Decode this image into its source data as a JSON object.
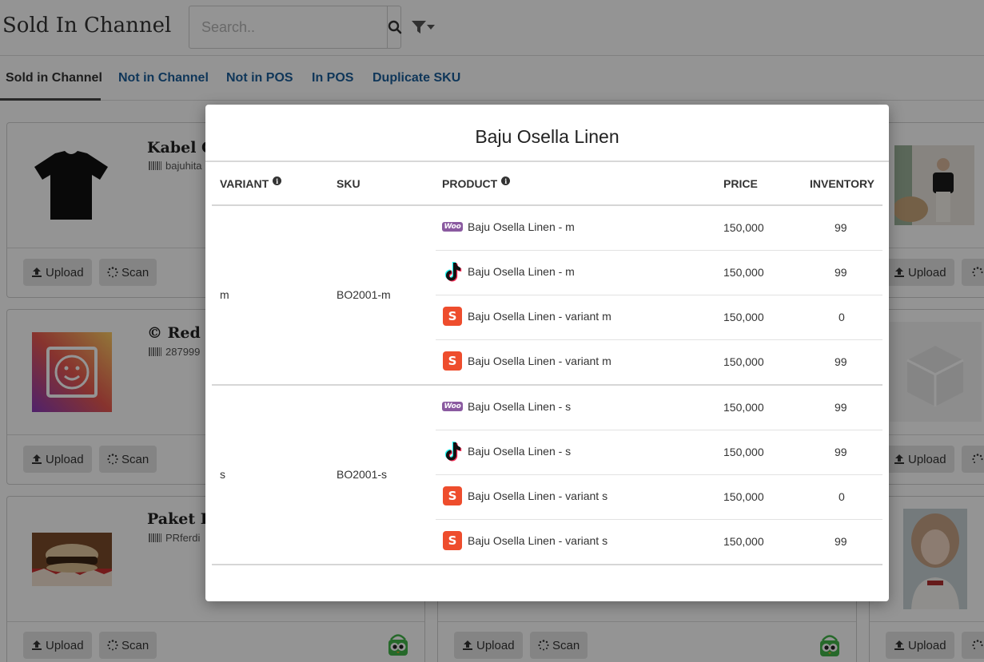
{
  "header": {
    "title": "Sold In Channel",
    "search_placeholder": "Search..",
    "search_icon": "search-icon",
    "filter_icon": "filter-icon"
  },
  "tabs": [
    {
      "label": "Sold in Channel",
      "active": true
    },
    {
      "label": "Not in Channel",
      "active": false
    },
    {
      "label": "Not in POS",
      "active": false
    },
    {
      "label": "In POS",
      "active": false
    },
    {
      "label": "Duplicate SKU",
      "active": false
    }
  ],
  "cards": [
    {
      "name": "Kabel C",
      "sku": "bajuhita",
      "upload_label": "Upload",
      "scan_label": "Scan"
    },
    {
      "name": "© Red S",
      "sku": "287999",
      "upload_label": "Upload",
      "scan_label": "Scan"
    },
    {
      "name": "Paket R",
      "sku": "PRferdi",
      "upload_label": "Upload",
      "scan_label": "Scan"
    }
  ],
  "right_cards": [
    {
      "upload_label": "Upload"
    },
    {
      "upload_label": "Upload"
    },
    {
      "upload_label": "Upload"
    }
  ],
  "middle_card": {
    "upload_label": "Upload",
    "scan_label": "Scan"
  },
  "modal": {
    "title": "Baju Osella Linen",
    "columns": {
      "variant": "VARIANT",
      "sku": "SKU",
      "product": "PRODUCT",
      "price": "PRICE",
      "inventory": "INVENTORY"
    },
    "groups": [
      {
        "variant": "m",
        "sku": "BO2001-m",
        "rows": [
          {
            "channel": "woocommerce",
            "product": "Baju Osella Linen - m",
            "price": "150,000",
            "inventory": "99"
          },
          {
            "channel": "tiktok",
            "product": "Baju Osella Linen - m",
            "price": "150,000",
            "inventory": "99"
          },
          {
            "channel": "shopee",
            "product": "Baju Osella Linen - variant m",
            "price": "150,000",
            "inventory": "0"
          },
          {
            "channel": "shopee",
            "product": "Baju Osella Linen - variant m",
            "price": "150,000",
            "inventory": "99"
          }
        ]
      },
      {
        "variant": "s",
        "sku": "BO2001-s",
        "rows": [
          {
            "channel": "woocommerce",
            "product": "Baju Osella Linen - s",
            "price": "150,000",
            "inventory": "99"
          },
          {
            "channel": "tiktok",
            "product": "Baju Osella Linen - s",
            "price": "150,000",
            "inventory": "99"
          },
          {
            "channel": "shopee",
            "product": "Baju Osella Linen - variant s",
            "price": "150,000",
            "inventory": "0"
          },
          {
            "channel": "shopee",
            "product": "Baju Osella Linen - variant s",
            "price": "150,000",
            "inventory": "99"
          }
        ]
      }
    ]
  },
  "icon_labels": {
    "woo": "Woo",
    "shopee": "S",
    "info": "i"
  },
  "colors": {
    "tab_link": "#1a5e9a",
    "woo": "#8a5aa0",
    "shopee": "#ee4d2d",
    "tokopedia": "#42b549"
  }
}
